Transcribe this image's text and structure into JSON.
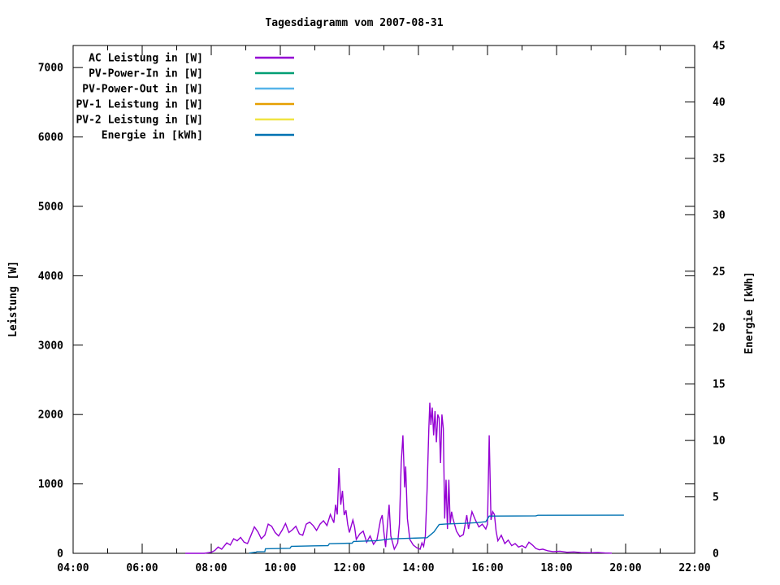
{
  "page": {
    "title": "Tagesdiagramm vom 2007-08-31"
  },
  "chart_data": {
    "type": "line",
    "title": "Tagesdiagramm vom 2007-08-31",
    "grid": false,
    "legend_position": "top-left-inside",
    "x_axis": {
      "label": "",
      "tick_labels": [
        "04:00",
        "06:00",
        "08:00",
        "10:00",
        "12:00",
        "14:00",
        "16:00",
        "18:00",
        "20:00",
        "22:00"
      ],
      "tick_hours": [
        4,
        6,
        8,
        10,
        12,
        14,
        16,
        18,
        20,
        22
      ],
      "minor_tick_hours": [
        5,
        7,
        9,
        11,
        13,
        15,
        17,
        19,
        21
      ],
      "range_hours": [
        4,
        22
      ]
    },
    "y_left_axis": {
      "label": "Leistung [W]",
      "ticks": [
        0,
        1000,
        2000,
        3000,
        4000,
        5000,
        6000,
        7000
      ],
      "range": [
        0,
        7318
      ]
    },
    "y_right_axis": {
      "label": "Energie [kWh]",
      "ticks": [
        0,
        5,
        10,
        15,
        20,
        25,
        30,
        35,
        40,
        45
      ],
      "range": [
        0,
        45
      ]
    },
    "colors": {
      "ac": "#9400d3",
      "pv_power_in": "#009e73",
      "pv_power_out": "#56b4e9",
      "pv1": "#e69f00",
      "pv2": "#f0e442",
      "energie": "#0072b2",
      "axis": "#000000",
      "background": "#ffffff"
    },
    "legend": [
      {
        "label": "AC Leistung in [W]",
        "color": "#9400d3"
      },
      {
        "label": "PV-Power-In in [W]",
        "color": "#009e73"
      },
      {
        "label": "PV-Power-Out in [W]",
        "color": "#56b4e9"
      },
      {
        "label": "PV-1 Leistung in [W]",
        "color": "#e69f00"
      },
      {
        "label": "PV-2 Leistung in [W]",
        "color": "#f0e442"
      },
      {
        "label": "Energie in [kWh]",
        "color": "#0072b2"
      }
    ],
    "series": [
      {
        "name": "AC Leistung in [W]",
        "color": "#9400d3",
        "axis": "left",
        "points": [
          [
            7.25,
            0
          ],
          [
            7.5,
            0
          ],
          [
            7.8,
            0
          ],
          [
            8.0,
            15
          ],
          [
            8.1,
            40
          ],
          [
            8.2,
            90
          ],
          [
            8.3,
            60
          ],
          [
            8.45,
            150
          ],
          [
            8.55,
            120
          ],
          [
            8.65,
            210
          ],
          [
            8.75,
            180
          ],
          [
            8.85,
            230
          ],
          [
            8.95,
            160
          ],
          [
            9.05,
            140
          ],
          [
            9.15,
            260
          ],
          [
            9.25,
            380
          ],
          [
            9.35,
            310
          ],
          [
            9.45,
            210
          ],
          [
            9.55,
            260
          ],
          [
            9.65,
            420
          ],
          [
            9.75,
            390
          ],
          [
            9.85,
            300
          ],
          [
            9.95,
            250
          ],
          [
            10.05,
            330
          ],
          [
            10.15,
            430
          ],
          [
            10.25,
            300
          ],
          [
            10.35,
            340
          ],
          [
            10.45,
            390
          ],
          [
            10.55,
            280
          ],
          [
            10.65,
            260
          ],
          [
            10.75,
            420
          ],
          [
            10.85,
            450
          ],
          [
            10.95,
            400
          ],
          [
            11.05,
            330
          ],
          [
            11.15,
            420
          ],
          [
            11.25,
            470
          ],
          [
            11.35,
            400
          ],
          [
            11.45,
            560
          ],
          [
            11.55,
            440
          ],
          [
            11.6,
            700
          ],
          [
            11.65,
            560
          ],
          [
            11.7,
            1230
          ],
          [
            11.75,
            700
          ],
          [
            11.8,
            900
          ],
          [
            11.85,
            550
          ],
          [
            11.9,
            620
          ],
          [
            11.95,
            420
          ],
          [
            12.0,
            300
          ],
          [
            12.1,
            480
          ],
          [
            12.15,
            380
          ],
          [
            12.2,
            200
          ],
          [
            12.3,
            280
          ],
          [
            12.4,
            320
          ],
          [
            12.5,
            160
          ],
          [
            12.6,
            250
          ],
          [
            12.7,
            130
          ],
          [
            12.8,
            200
          ],
          [
            12.9,
            480
          ],
          [
            12.95,
            550
          ],
          [
            13.0,
            300
          ],
          [
            13.05,
            90
          ],
          [
            13.1,
            400
          ],
          [
            13.15,
            700
          ],
          [
            13.2,
            250
          ],
          [
            13.3,
            60
          ],
          [
            13.4,
            150
          ],
          [
            13.45,
            420
          ],
          [
            13.5,
            1300
          ],
          [
            13.55,
            1700
          ],
          [
            13.6,
            950
          ],
          [
            13.63,
            1250
          ],
          [
            13.68,
            500
          ],
          [
            13.75,
            200
          ],
          [
            13.85,
            120
          ],
          [
            13.95,
            80
          ],
          [
            14.05,
            60
          ],
          [
            14.1,
            150
          ],
          [
            14.15,
            100
          ],
          [
            14.2,
            250
          ],
          [
            14.25,
            900
          ],
          [
            14.3,
            1800
          ],
          [
            14.33,
            2170
          ],
          [
            14.36,
            1850
          ],
          [
            14.4,
            2100
          ],
          [
            14.44,
            1700
          ],
          [
            14.48,
            2050
          ],
          [
            14.52,
            1600
          ],
          [
            14.56,
            2000
          ],
          [
            14.6,
            1950
          ],
          [
            14.64,
            1300
          ],
          [
            14.68,
            2000
          ],
          [
            14.72,
            1800
          ],
          [
            14.76,
            500
          ],
          [
            14.8,
            1060
          ],
          [
            14.84,
            350
          ],
          [
            14.88,
            1060
          ],
          [
            14.92,
            420
          ],
          [
            14.96,
            600
          ],
          [
            15.0,
            500
          ],
          [
            15.1,
            320
          ],
          [
            15.2,
            240
          ],
          [
            15.3,
            270
          ],
          [
            15.4,
            550
          ],
          [
            15.45,
            350
          ],
          [
            15.55,
            600
          ],
          [
            15.65,
            480
          ],
          [
            15.75,
            380
          ],
          [
            15.85,
            420
          ],
          [
            15.95,
            350
          ],
          [
            16.0,
            420
          ],
          [
            16.05,
            1700
          ],
          [
            16.1,
            480
          ],
          [
            16.15,
            600
          ],
          [
            16.2,
            560
          ],
          [
            16.25,
            320
          ],
          [
            16.3,
            180
          ],
          [
            16.4,
            260
          ],
          [
            16.5,
            140
          ],
          [
            16.6,
            190
          ],
          [
            16.7,
            110
          ],
          [
            16.8,
            140
          ],
          [
            16.9,
            90
          ],
          [
            17.0,
            110
          ],
          [
            17.1,
            80
          ],
          [
            17.2,
            160
          ],
          [
            17.3,
            120
          ],
          [
            17.4,
            70
          ],
          [
            17.5,
            50
          ],
          [
            17.6,
            60
          ],
          [
            17.75,
            35
          ],
          [
            17.9,
            25
          ],
          [
            18.1,
            30
          ],
          [
            18.3,
            15
          ],
          [
            18.5,
            20
          ],
          [
            18.7,
            10
          ],
          [
            19.0,
            8
          ],
          [
            19.2,
            10
          ],
          [
            19.4,
            5
          ],
          [
            19.6,
            2
          ]
        ]
      },
      {
        "name": "PV-Power-In in [W]",
        "color": "#009e73",
        "axis": "left",
        "points": []
      },
      {
        "name": "PV-Power-Out in [W]",
        "color": "#56b4e9",
        "axis": "left",
        "points": []
      },
      {
        "name": "PV-1 Leistung in [W]",
        "color": "#e69f00",
        "axis": "left",
        "points": []
      },
      {
        "name": "PV-2 Leistung in [W]",
        "color": "#f0e442",
        "axis": "left",
        "points": []
      },
      {
        "name": "Energie in [kWh]",
        "color": "#0072b2",
        "axis": "right",
        "points": [
          [
            9.1,
            0.02
          ],
          [
            9.3,
            0.1
          ],
          [
            9.32,
            0.14
          ],
          [
            9.55,
            0.15
          ],
          [
            9.57,
            0.4
          ],
          [
            10.28,
            0.45
          ],
          [
            10.32,
            0.62
          ],
          [
            11.0,
            0.66
          ],
          [
            11.38,
            0.68
          ],
          [
            11.42,
            0.85
          ],
          [
            12.08,
            0.9
          ],
          [
            12.12,
            1.05
          ],
          [
            12.8,
            1.12
          ],
          [
            13.2,
            1.28
          ],
          [
            13.6,
            1.32
          ],
          [
            14.25,
            1.38
          ],
          [
            14.45,
            1.9
          ],
          [
            14.6,
            2.55
          ],
          [
            14.8,
            2.6
          ],
          [
            15.3,
            2.65
          ],
          [
            15.7,
            2.72
          ],
          [
            15.95,
            2.8
          ],
          [
            16.05,
            3.3
          ],
          [
            17.4,
            3.32
          ],
          [
            17.46,
            3.37
          ],
          [
            19.95,
            3.38
          ]
        ]
      }
    ]
  }
}
